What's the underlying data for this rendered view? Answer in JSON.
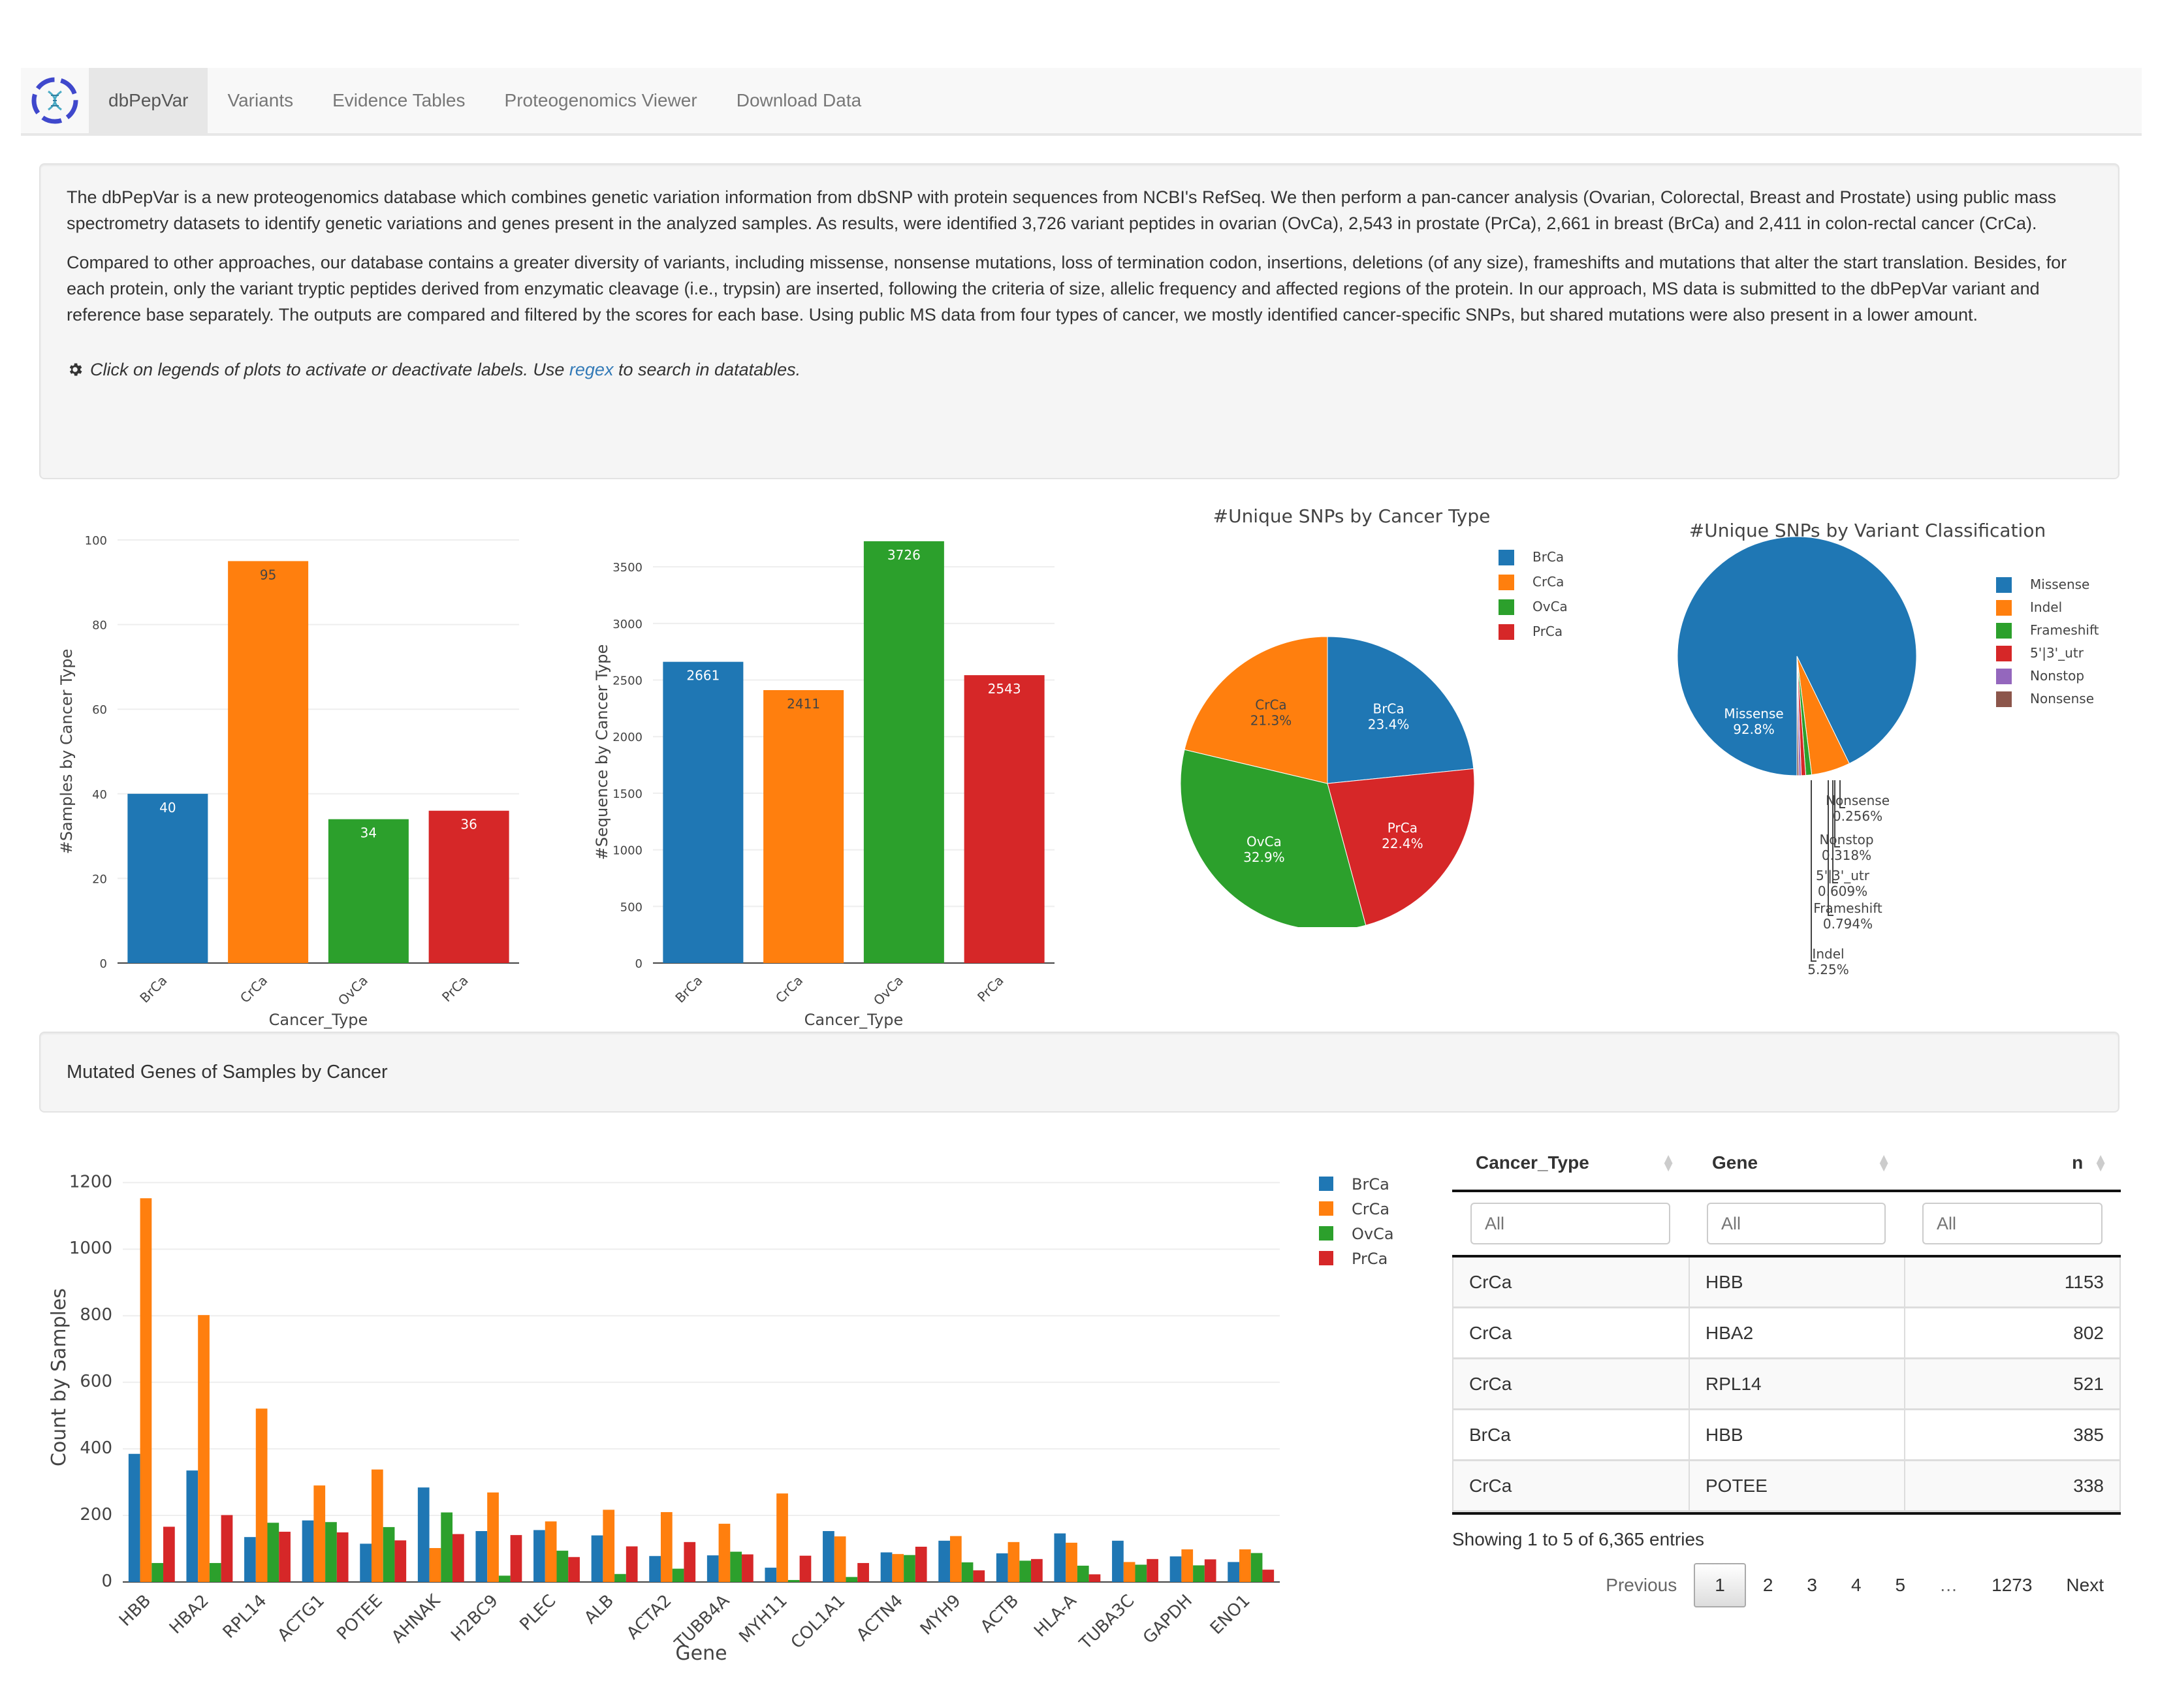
{
  "nav": {
    "logo": "dbPepVar logo",
    "items": [
      {
        "label": "dbPepVar",
        "active": true
      },
      {
        "label": "Variants"
      },
      {
        "label": "Evidence Tables"
      },
      {
        "label": "Proteogenomics Viewer"
      },
      {
        "label": "Download Data"
      }
    ]
  },
  "intro": {
    "p1": "The dbPepVar is a new proteogenomics database which combines genetic variation information from dbSNP with protein sequences from NCBI's RefSeq. We then perform a pan-cancer analysis (Ovarian, Colorectal, Breast and Prostate) using public mass spectrometry datasets to identify genetic variations and genes present in the analyzed samples. As results, were identified 3,726 variant peptides in ovarian (OvCa), 2,543 in prostate (PrCa), 2,661 in breast (BrCa) and 2,411 in colon-rectal cancer (CrCa).",
    "p2": "Compared to other approaches, our database contains a greater diversity of variants, including missense, nonsense mutations, loss of termination codon, insertions, deletions (of any size), frameshifts and mutations that alter the start translation. Besides, for each protein, only the variant tryptic peptides derived from enzymatic cleavage (i.e., trypsin) are inserted, following the criteria of size, allelic frequency and affected regions of the protein. In our approach, MS data is submitted to the dbPepVar variant and reference base separately. The outputs are compared and filtered by the scores for each base. Using public MS data from four types of cancer, we mostly identified cancer-specific SNPs, but shared mutations were also present in a lower amount.",
    "tip_before": "Click on legends of plots to activate or deactivate labels. Use ",
    "tip_link": "regex",
    "tip_after": " to search in datatables."
  },
  "colors": {
    "BrCa": "#1f77b4",
    "CrCa": "#ff7f0e",
    "OvCa": "#2ca02c",
    "PrCa": "#d62728",
    "Missense": "#1f77b4",
    "Indel": "#ff7f0e",
    "Frameshift": "#2ca02c",
    "5'|3'_utr": "#d62728",
    "Nonstop": "#9467bd",
    "Nonsense": "#8c564b",
    "link": "#337ab7"
  },
  "mutated_section_title": "Mutated Genes of Samples by Cancer",
  "chart_data": [
    {
      "id": "samples",
      "type": "bar",
      "title": "",
      "categories": [
        "BrCa",
        "CrCa",
        "OvCa",
        "PrCa"
      ],
      "values": [
        40,
        95,
        34,
        36
      ],
      "xlabel": "Cancer_Type",
      "ylabel": "#Samples by Cancer Type",
      "ylim": [
        0,
        100
      ],
      "yticks": [
        0,
        20,
        40,
        60,
        80,
        100
      ],
      "grid": true
    },
    {
      "id": "sequences",
      "type": "bar",
      "title": "",
      "categories": [
        "BrCa",
        "CrCa",
        "OvCa",
        "PrCa"
      ],
      "values": [
        2661,
        2411,
        3726,
        2543
      ],
      "xlabel": "Cancer_Type",
      "ylabel": "#Sequence by Cancer Type",
      "ylim": [
        0,
        3726
      ],
      "yticks": [
        0,
        500,
        1000,
        1500,
        2000,
        2500,
        3000,
        3500
      ],
      "grid": true
    },
    {
      "id": "snps_cancer",
      "type": "pie",
      "title": "#Unique SNPs by Cancer Type",
      "labels": [
        "BrCa",
        "PrCa",
        "OvCa",
        "CrCa"
      ],
      "percents": [
        23.4,
        22.4,
        32.9,
        21.3
      ],
      "legend": [
        "BrCa",
        "CrCa",
        "OvCa",
        "PrCa"
      ],
      "legend_position": "top-right"
    },
    {
      "id": "snps_class",
      "type": "pie",
      "title": "#Unique SNPs by Variant Classification",
      "labels": [
        "Missense",
        "Indel",
        "Frameshift",
        "5'|3'_utr",
        "Nonstop",
        "Nonsense"
      ],
      "percent_labels": [
        "92.8%",
        "5.25%",
        "0.794%",
        "0.609%",
        "0.318%",
        "0.256%"
      ],
      "percents": [
        92.8,
        5.25,
        0.794,
        0.609,
        0.318,
        0.256
      ],
      "legend_position": "top-right"
    },
    {
      "id": "genes",
      "type": "bar",
      "title": "",
      "xlabel": "Gene",
      "ylabel": "Count by Samples",
      "ylim": [
        0,
        1230
      ],
      "yticks": [
        0,
        200,
        400,
        600,
        800,
        1000,
        1200
      ],
      "grid": true,
      "legend_position": "top-right",
      "categories": [
        "HBB",
        "HBA2",
        "RPL14",
        "ACTG1",
        "POTEE",
        "AHNAK",
        "H2BC9",
        "PLEC",
        "ALB",
        "ACTA2",
        "TUBB4A",
        "MYH11",
        "COL1A1",
        "ACTN4",
        "MYH9",
        "ACTB",
        "HLA-A",
        "TUBA3C",
        "GAPDH",
        "ENO1"
      ],
      "series": [
        {
          "name": "BrCa",
          "values": [
            385,
            335,
            135,
            185,
            115,
            284,
            153,
            156,
            140,
            78,
            80,
            43,
            153,
            89,
            124,
            86,
            146,
            124,
            77,
            60
          ]
        },
        {
          "name": "CrCa",
          "values": [
            1153,
            802,
            521,
            290,
            338,
            102,
            269,
            182,
            217,
            210,
            175,
            266,
            137,
            84,
            138,
            120,
            118,
            60,
            98,
            98
          ]
        },
        {
          "name": "OvCa",
          "values": [
            57,
            57,
            178,
            180,
            165,
            209,
            19,
            94,
            24,
            40,
            91,
            6,
            15,
            81,
            59,
            64,
            49,
            52,
            50,
            87
          ]
        },
        {
          "name": "PrCa",
          "values": [
            166,
            201,
            151,
            149,
            125,
            144,
            141,
            75,
            107,
            120,
            83,
            79,
            57,
            106,
            35,
            69,
            23,
            69,
            68,
            37
          ]
        }
      ]
    }
  ],
  "table": {
    "columns": [
      "Cancer_Type",
      "Gene",
      "n"
    ],
    "filter_placeholder": "All",
    "rows": [
      [
        "CrCa",
        "HBB",
        "1153"
      ],
      [
        "CrCa",
        "HBA2",
        "802"
      ],
      [
        "CrCa",
        "RPL14",
        "521"
      ],
      [
        "BrCa",
        "HBB",
        "385"
      ],
      [
        "CrCa",
        "POTEE",
        "338"
      ]
    ],
    "info": "Showing 1 to 5 of 6,365 entries",
    "pagination": {
      "previous": "Previous",
      "pages": [
        "1",
        "2",
        "3",
        "4",
        "5",
        "…",
        "1273"
      ],
      "current": "1",
      "next": "Next"
    }
  }
}
